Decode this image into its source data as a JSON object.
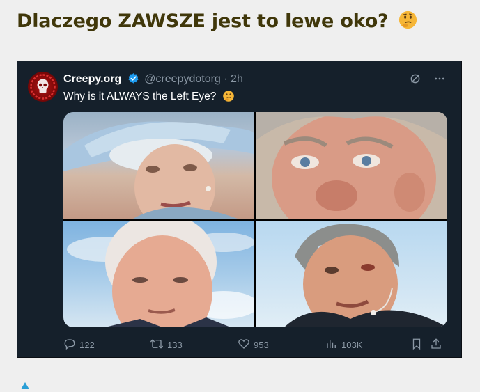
{
  "article": {
    "title": "Dlaczego ZAWSZE jest to lewe oko?",
    "title_emoji_icon": "thinking-face-emoji"
  },
  "tweet": {
    "author_name": "Creepy.org",
    "handle_time": "@creepydotorg · 2h",
    "text": "Why is it ALWAYS the Left Eye?",
    "text_emoji_icon": "thinking-face-emoji",
    "media": [
      {
        "icon": "photo-queen-elizabeth"
      },
      {
        "icon": "photo-king-charles"
      },
      {
        "icon": "photo-joe-biden"
      },
      {
        "icon": "photo-man-with-headset-mic"
      }
    ],
    "actions": {
      "replies": "122",
      "retweets": "133",
      "likes": "953",
      "views": "103K"
    }
  },
  "colors": {
    "title": "#40370a",
    "tweet_bg": "#15202b",
    "muted": "#8b98a5",
    "verified": "#1d9bf0"
  }
}
